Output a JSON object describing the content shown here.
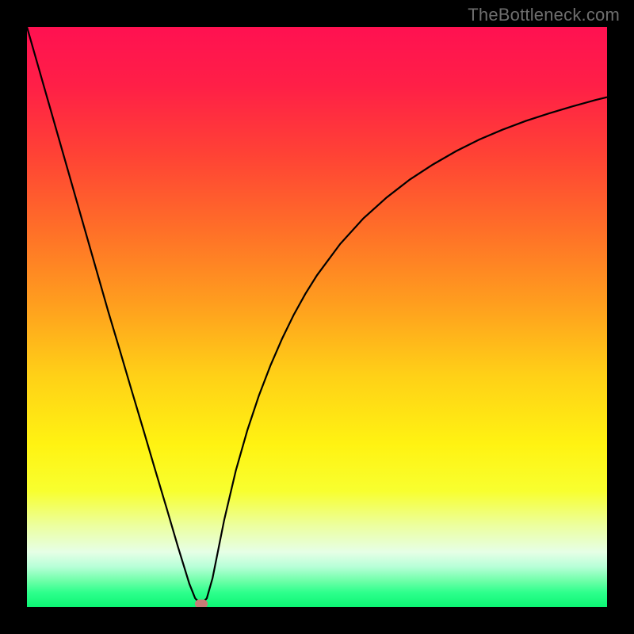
{
  "watermark": {
    "text": "TheBottleneck.com"
  },
  "chart_data": {
    "type": "line",
    "title": "",
    "xlabel": "",
    "ylabel": "",
    "xlim": [
      0,
      100
    ],
    "ylim": [
      0,
      100
    ],
    "grid": false,
    "legend": false,
    "background_gradient": {
      "orientation": "vertical",
      "stops": [
        {
          "pos": 0.0,
          "color": "#ff1151"
        },
        {
          "pos": 0.1,
          "color": "#ff1f47"
        },
        {
          "pos": 0.22,
          "color": "#ff4235"
        },
        {
          "pos": 0.35,
          "color": "#ff6f28"
        },
        {
          "pos": 0.48,
          "color": "#ff9f1e"
        },
        {
          "pos": 0.6,
          "color": "#ffd017"
        },
        {
          "pos": 0.72,
          "color": "#fff312"
        },
        {
          "pos": 0.8,
          "color": "#f8ff2f"
        },
        {
          "pos": 0.86,
          "color": "#ecffa0"
        },
        {
          "pos": 0.905,
          "color": "#e6ffe6"
        },
        {
          "pos": 0.93,
          "color": "#b8ffd8"
        },
        {
          "pos": 0.955,
          "color": "#6effa8"
        },
        {
          "pos": 0.975,
          "color": "#2dff8c"
        },
        {
          "pos": 1.0,
          "color": "#0cf574"
        }
      ]
    },
    "series": [
      {
        "name": "bottleneck-curve",
        "color": "#000000",
        "stroke_width": 2.2,
        "x": [
          0,
          2,
          4,
          6,
          8,
          10,
          12,
          14,
          16,
          18,
          20,
          22,
          24,
          26,
          28,
          29,
          30,
          31,
          32,
          33,
          34,
          36,
          38,
          40,
          42,
          44,
          46,
          48,
          50,
          54,
          58,
          62,
          66,
          70,
          74,
          78,
          82,
          86,
          90,
          94,
          98,
          100
        ],
        "y": [
          100,
          93.0,
          86.0,
          79.0,
          72.0,
          65.0,
          58.0,
          51.0,
          44.3,
          37.5,
          30.8,
          24.0,
          17.3,
          10.5,
          4.0,
          1.5,
          0.5,
          1.5,
          5.0,
          10.0,
          15.0,
          23.5,
          30.5,
          36.5,
          41.7,
          46.3,
          50.4,
          54.0,
          57.2,
          62.6,
          67.0,
          70.6,
          73.7,
          76.3,
          78.6,
          80.6,
          82.3,
          83.8,
          85.1,
          86.3,
          87.4,
          87.9
        ]
      }
    ],
    "marker": {
      "x": 30,
      "y": 0.5,
      "color": "#c77c77"
    }
  }
}
